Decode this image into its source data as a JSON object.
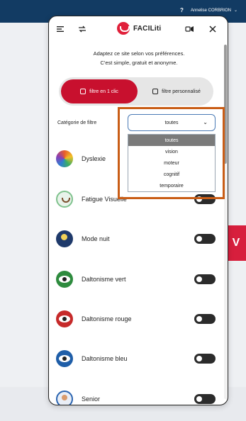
{
  "site": {
    "help_icon": "?",
    "user_name": "Annelise CORBRION",
    "chevron": "⌄",
    "red_tab_glyph": "V"
  },
  "panel": {
    "icons": {
      "menu": "menu-icon",
      "swap": "swap-icon",
      "audio": "speaker-icon",
      "close": "close-icon"
    },
    "logo_text": "FACILiti",
    "intro_line1": "Adaptez ce site selon vos préférences.",
    "intro_line2": "C'est simple, gratuit et anonyme.",
    "mode_active_label": "filtre en 1 clic",
    "mode_inactive_label": "filtre personnalisé",
    "filter_category_label": "Catégorie de filtre",
    "select": {
      "value": "toutes",
      "options": [
        "toutes",
        "vision",
        "moteur",
        "cognitif",
        "temporaire"
      ]
    },
    "profiles": [
      {
        "label": "Dyslexie",
        "icon": "rainbow-circle-icon"
      },
      {
        "label": "Fatigue Visuelle",
        "icon": "tired-eye-icon"
      },
      {
        "label": "Mode nuit",
        "icon": "moon-icon"
      },
      {
        "label": "Daltonisme vert",
        "icon": "green-eye-icon"
      },
      {
        "label": "Daltonisme rouge",
        "icon": "red-eye-icon"
      },
      {
        "label": "Daltonisme bleu",
        "icon": "blue-eye-icon"
      },
      {
        "label": "Senior",
        "icon": "senior-icon"
      }
    ],
    "colors": {
      "accent": "#c8102e",
      "highlight_box": "#c95d16"
    }
  }
}
